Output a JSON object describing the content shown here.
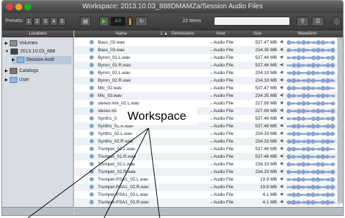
{
  "window": {
    "title": "Workspace: 2013.10.03_888DMAMZa/Session Audio Files"
  },
  "toolbar": {
    "presets_label": "Presets:",
    "presets": [
      "1",
      "2",
      "3",
      "4",
      "5"
    ],
    "level_value": "0.0",
    "item_count": "22 Items"
  },
  "locations": {
    "header": "Locations",
    "items": [
      {
        "label": "Volumes",
        "expanded": false
      },
      {
        "label": "2013.10.03_888",
        "expanded": true
      },
      {
        "label": "Session Audi",
        "expanded": false
      },
      {
        "label": "Catalogs",
        "expanded": false
      },
      {
        "label": "User",
        "expanded": false
      }
    ]
  },
  "columns": {
    "name": "Name",
    "sort": "1 ▲",
    "permissions": "Permissions",
    "kind": "Kind",
    "size": "Size",
    "waveform": "Waveform"
  },
  "files": [
    {
      "name": "Bass_02.wav",
      "kind": "Audio File",
      "size": "537.47 MB"
    },
    {
      "name": "Bass_03.wav",
      "kind": "Audio File",
      "size": "234.35 MB"
    },
    {
      "name": "Byron_01.L.wav",
      "kind": "Audio File",
      "size": "537.46 MB"
    },
    {
      "name": "Byron_01.R.wav",
      "kind": "Audio File",
      "size": "537.46 MB"
    },
    {
      "name": "Byron_02.L.wav",
      "kind": "Audio File",
      "size": "234.33 MB"
    },
    {
      "name": "Byron_02.R.wav",
      "kind": "Audio File",
      "size": "234.33 MB"
    },
    {
      "name": "Mic_02.wav",
      "kind": "Audio File",
      "size": "537.47 MB"
    },
    {
      "name": "Mic_03.wav",
      "kind": "Audio File",
      "size": "234.35 MB"
    },
    {
      "name": "stereo mix_02.L.wav",
      "kind": "Audio File",
      "size": "227.89 MB"
    },
    {
      "name": "stereo mix_02.R.wav",
      "kind": "Audio File",
      "size": "227.89 MB"
    },
    {
      "name": "Synths_01.L.wav",
      "kind": "Audio File",
      "size": "537.46 MB"
    },
    {
      "name": "Synths_01.R.wav",
      "kind": "Audio File",
      "size": "537.46 MB"
    },
    {
      "name": "Synths_02.L.wav",
      "kind": "Audio File",
      "size": "234.33 MB"
    },
    {
      "name": "Synths_02.R.wav",
      "kind": "Audio File",
      "size": "234.33 MB"
    },
    {
      "name": "Trumpet_01.L.wav",
      "kind": "Audio File",
      "size": "537.46 MB"
    },
    {
      "name": "Trumpet_01.R.wav",
      "kind": "Audio File",
      "size": "537.46 MB"
    },
    {
      "name": "Trumpet_02.L.wav",
      "kind": "Audio File",
      "size": "234.33 MB"
    },
    {
      "name": "Trumpet_02.R.wav",
      "kind": "Audio File",
      "size": "234.33 MB"
    },
    {
      "name": "Trumpet-PSA1_02.L.wav",
      "kind": "Audio File",
      "size": "19.9 MB"
    },
    {
      "name": "Trumpet-PSA1_02.R.wav",
      "kind": "Audio File",
      "size": "19.9 MB"
    },
    {
      "name": "Trumpet-PSA1_03.L.wav",
      "kind": "Audio File",
      "size": "4.1 MB"
    },
    {
      "name": "Trumpet-PSA1_03.R.wav",
      "kind": "Audio File",
      "size": "4.1 MB"
    }
  ],
  "callout": {
    "label": "Workspace"
  },
  "colors": {
    "accent": "#7f9fc6",
    "waveform": "#6f8fc0"
  }
}
